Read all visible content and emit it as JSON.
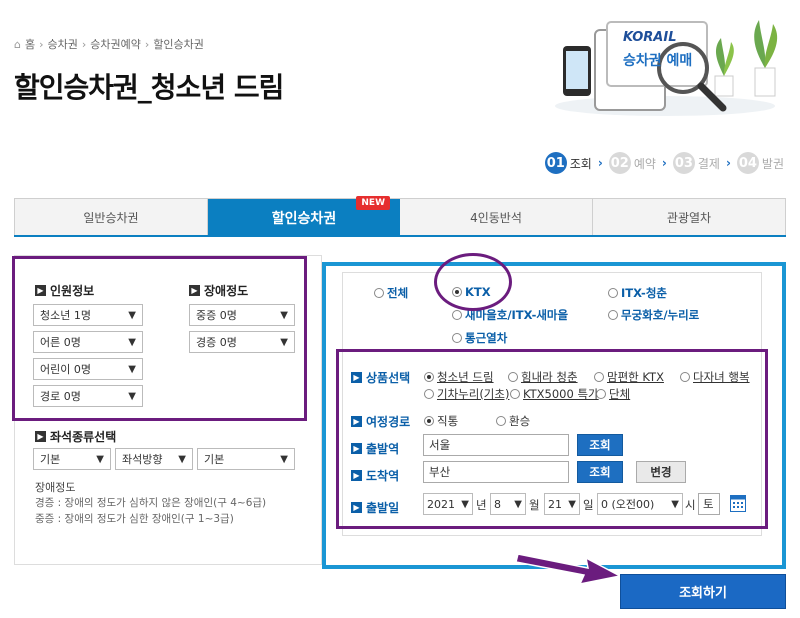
{
  "breadcrumb": [
    "홈",
    "승차권",
    "승차권예약",
    "할인승차권"
  ],
  "page_title": "할인승차권_청소년 드림",
  "banner": {
    "brand": "KORAIL",
    "label": "승차권 예매"
  },
  "steps": [
    {
      "num": "01",
      "label": "조회",
      "active": true
    },
    {
      "num": "02",
      "label": "예약",
      "active": false
    },
    {
      "num": "03",
      "label": "결제",
      "active": false
    },
    {
      "num": "04",
      "label": "발권",
      "active": false
    }
  ],
  "tabs": [
    {
      "label": "일반승차권"
    },
    {
      "label": "할인승차권",
      "badge": "NEW"
    },
    {
      "label": "4인동반석"
    },
    {
      "label": "관광열차"
    }
  ],
  "left": {
    "passenger_title": "인원정보",
    "disability_title": "장애정도",
    "passengers": [
      "청소년 1명",
      "어른 0명",
      "어린이 0명",
      "경로 0명"
    ],
    "disability": [
      "중증 0명",
      "경증 0명"
    ],
    "seat_title": "좌석종류선택",
    "seat_selects": [
      "기본",
      "좌석방향",
      "기본"
    ],
    "note_title": "장애정도",
    "notes": [
      "경증 : 장애의 정도가 심하지 않은 장애인(구 4~6급)",
      "중증 : 장애의 정도가 심한 장애인(구 1~3급)"
    ]
  },
  "train_types": {
    "all": "전체",
    "ktx": "KTX",
    "itx_chungchun": "ITX-청춘",
    "saemaeul": "새마을호/ITX-새마을",
    "mugunghwa": "무궁화호/누리로",
    "commuter": "통근열차"
  },
  "form": {
    "product_label": "상품선택",
    "products": [
      "청소년 드림",
      "힘내라 청춘",
      "맘편한 KTX",
      "다자녀 행복",
      "기차누리(기초)",
      "KTX5000 특가",
      "단체"
    ],
    "route_label": "여정경로",
    "route_direct": "직통",
    "route_transfer": "환승",
    "departure_label": "출발역",
    "departure_value": "서울",
    "arrival_label": "도착역",
    "arrival_value": "부산",
    "search_btn": "조회",
    "swap_btn": "변경",
    "date_label": "출발일",
    "year": "2021",
    "year_unit": "년",
    "month": "8",
    "month_unit": "월",
    "day": "21",
    "day_unit": "일",
    "hour": "0 (오전00)",
    "hour_unit": "시",
    "weekday": "토"
  },
  "submit_label": "조회하기",
  "colors": {
    "primary": "#1e6fc1",
    "tab_active": "#0b7fc1",
    "highlight": "#6b1c7e",
    "panel_border": "#1a96d4"
  }
}
